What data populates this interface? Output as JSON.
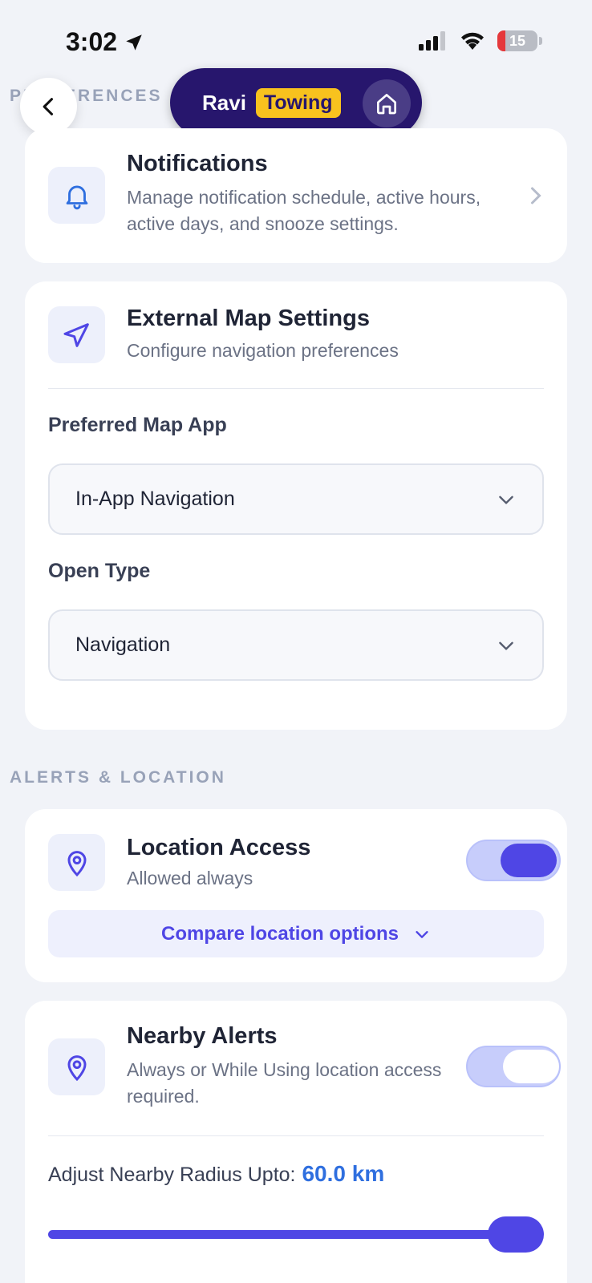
{
  "status_bar": {
    "time": "3:02",
    "battery": "15"
  },
  "header": {
    "section_label": "PREFERENCES",
    "brand_name": "Ravi",
    "brand_badge": "Towing"
  },
  "notifications": {
    "title": "Notifications",
    "description": "Manage notification schedule, active hours, active days, and snooze settings."
  },
  "map_settings": {
    "title": "External Map Settings",
    "description": "Configure navigation preferences",
    "preferred_label": "Preferred Map App",
    "preferred_value": "In-App Navigation",
    "open_type_label": "Open Type",
    "open_type_value": "Navigation"
  },
  "alerts_section": {
    "label": "ALERTS & LOCATION"
  },
  "location_access": {
    "title": "Location Access",
    "status": "Allowed always",
    "enabled": true,
    "compare_label": "Compare location options"
  },
  "nearby_alerts": {
    "title": "Nearby Alerts",
    "description": "Always or While Using location access required.",
    "enabled": false,
    "radius_label": "Adjust Nearby Radius Upto:",
    "radius_value": "60.0 km",
    "radius_fraction": 1.0
  },
  "colors": {
    "accent": "#4f46e5",
    "brand": "#27166d",
    "badge": "#f8c21e",
    "link": "#2f6fdf"
  }
}
